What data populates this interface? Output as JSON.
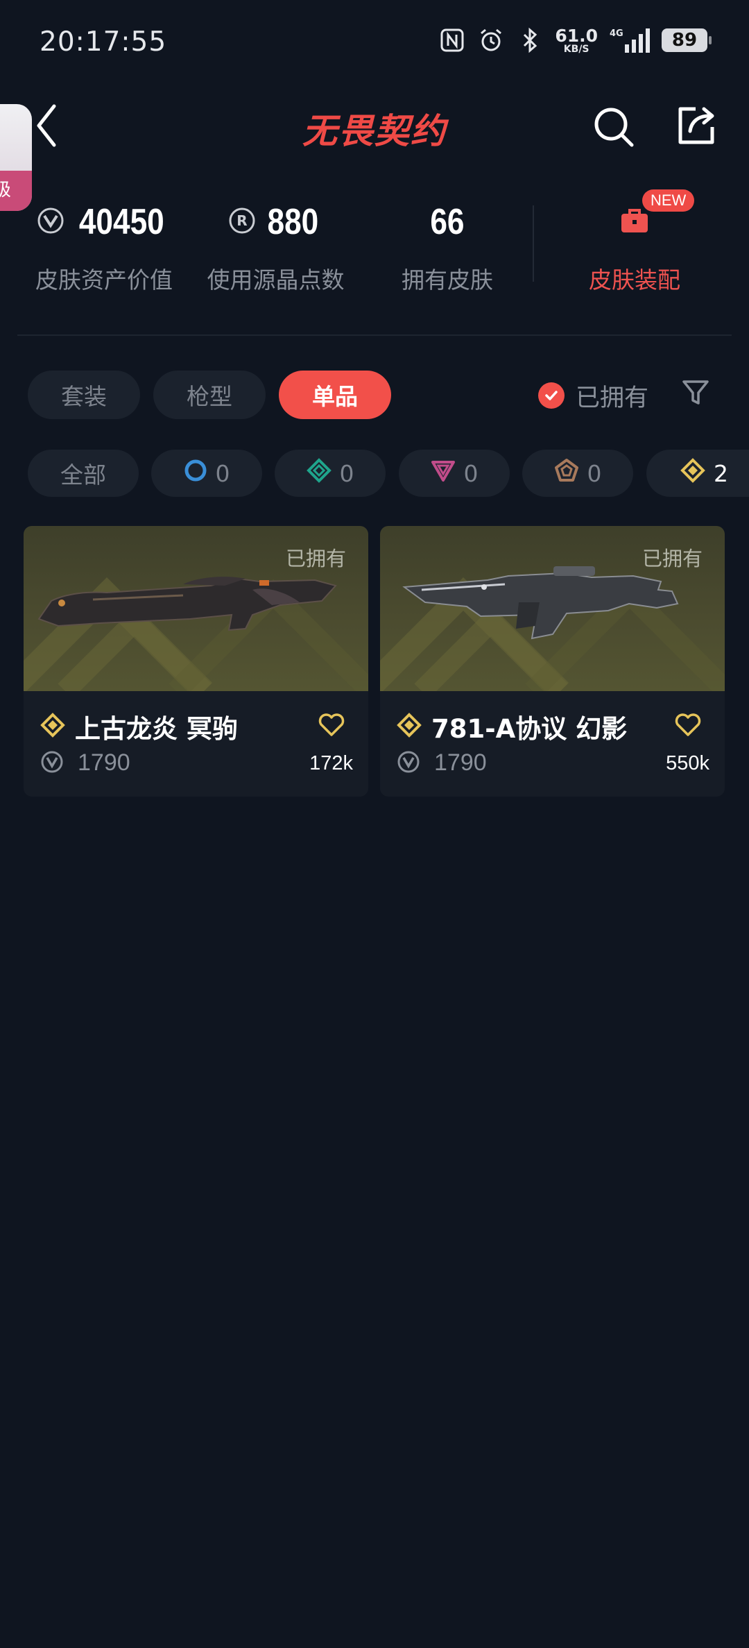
{
  "status_bar": {
    "time": "20:17:55",
    "net_speed_value": "61.0",
    "net_speed_unit": "KB/S",
    "network": "4G",
    "battery": "89",
    "icons": [
      "nfc-icon",
      "alarm-icon",
      "bluetooth-icon",
      "signal-icon",
      "battery-icon"
    ]
  },
  "header": {
    "logo_text": "无畏契约",
    "side_tab_text": "级",
    "icons": [
      "back-icon",
      "search-icon",
      "share-icon"
    ],
    "accent_color": "#ef4a46"
  },
  "stats": [
    {
      "value": "40450",
      "label": "皮肤资产价值",
      "icon": "valorant-point-icon"
    },
    {
      "value": "880",
      "label": "使用源晶点数",
      "icon": "radianite-icon"
    },
    {
      "value": "66",
      "label": "拥有皮肤",
      "icon": ""
    }
  ],
  "equip": {
    "label": "皮肤装配",
    "badge": "NEW",
    "icon": "toolbox-icon"
  },
  "tabs": [
    {
      "label": "套装",
      "active": false
    },
    {
      "label": "枪型",
      "active": false
    },
    {
      "label": "单品",
      "active": true
    }
  ],
  "owned_filter": {
    "label": "已拥有",
    "checked": true
  },
  "rarity_chips": [
    {
      "label": "全部",
      "icon": ""
    },
    {
      "label": "0",
      "icon": "select-tier-icon",
      "color": "#3a8fd8"
    },
    {
      "label": "0",
      "icon": "deluxe-tier-icon",
      "color": "#1fa58c"
    },
    {
      "label": "0",
      "icon": "premium-tier-icon",
      "color": "#c14c8a"
    },
    {
      "label": "0",
      "icon": "ultra-tier-icon",
      "color": "#a87a5c"
    },
    {
      "label": "2",
      "icon": "exclusive-tier-icon",
      "color": "#e6c45a"
    }
  ],
  "items": [
    {
      "name": "上古龙炎 冥驹",
      "price": "1790",
      "likes": "172k",
      "owned_tag": "已拥有",
      "rarity_icon": "exclusive-tier-icon"
    },
    {
      "name": "781-A协议 幻影",
      "price": "1790",
      "likes": "550k",
      "owned_tag": "已拥有",
      "rarity_icon": "exclusive-tier-icon"
    }
  ]
}
